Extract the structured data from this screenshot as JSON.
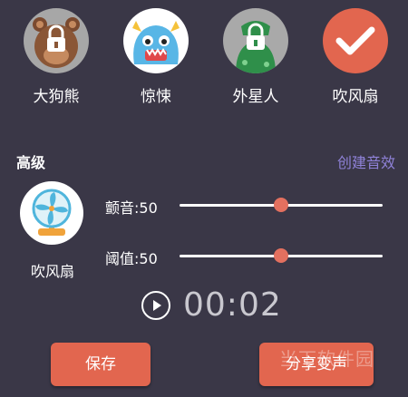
{
  "effects": [
    {
      "label": "大狗熊",
      "icon": "bear-lock-icon"
    },
    {
      "label": "惊悚",
      "icon": "monster-icon"
    },
    {
      "label": "外星人",
      "icon": "alien-lock-icon"
    },
    {
      "label": "吹风扇",
      "icon": "checkmark-icon"
    }
  ],
  "advanced": {
    "title": "高级",
    "create_link": "创建音效",
    "current_effect": "吹风扇",
    "current_effect_icon": "fan-icon"
  },
  "sliders": {
    "vibrato": {
      "label": "颤音:50",
      "value": 50
    },
    "threshold": {
      "label": "阈值:50",
      "value": 50
    }
  },
  "player": {
    "time": "00:02",
    "play_icon": "play-icon"
  },
  "buttons": {
    "save": "保存",
    "share": "分享变声"
  },
  "watermark": "当下软件园",
  "colors": {
    "background": "#3a3747",
    "accent": "#e2664f",
    "link": "#8f82d8"
  }
}
